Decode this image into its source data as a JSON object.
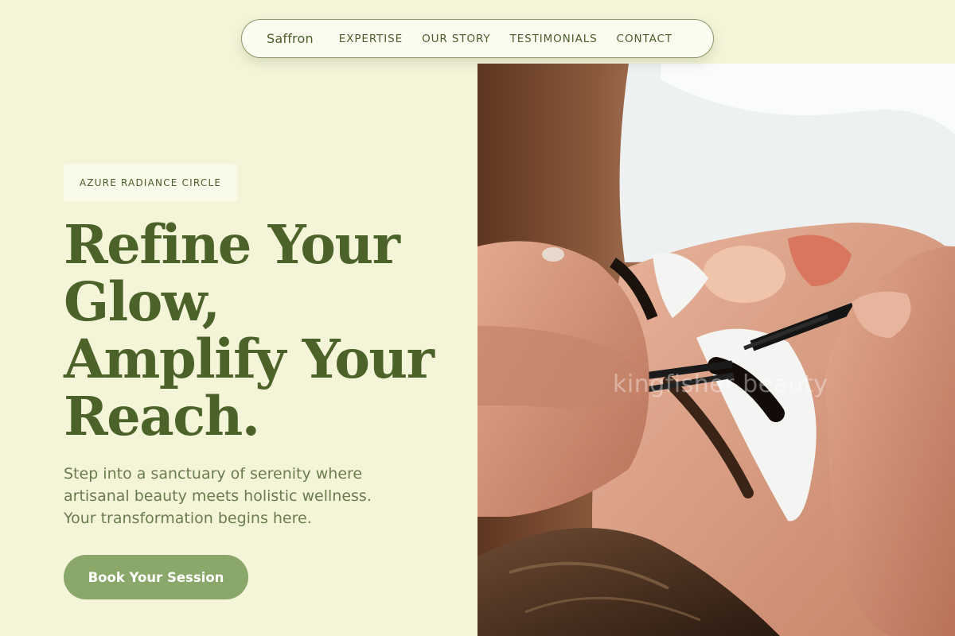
{
  "nav": {
    "brand": "Saffron",
    "links": [
      "EXPERTISE",
      "OUR STORY",
      "TESTIMONIALS",
      "CONTACT"
    ]
  },
  "hero": {
    "badge": "AZURE RADIANCE CIRCLE",
    "headline_lines": [
      "Refine Your",
      "Glow,",
      "Amplify Your",
      "Reach."
    ],
    "subtext_lines": [
      "Step into a sanctuary of serenity where",
      "artisanal beauty meets holistic wellness.",
      "Your transformation begins here."
    ],
    "cta_label": "Book Your Session"
  },
  "image": {
    "subject": "lash-extension-photo",
    "watermark": "kingfisher beauty"
  },
  "colors": {
    "background": "#f4f4d9",
    "primary_text": "#4b6329",
    "accent_button": "#8aa86a",
    "nav_border": "#8a9a6a"
  }
}
